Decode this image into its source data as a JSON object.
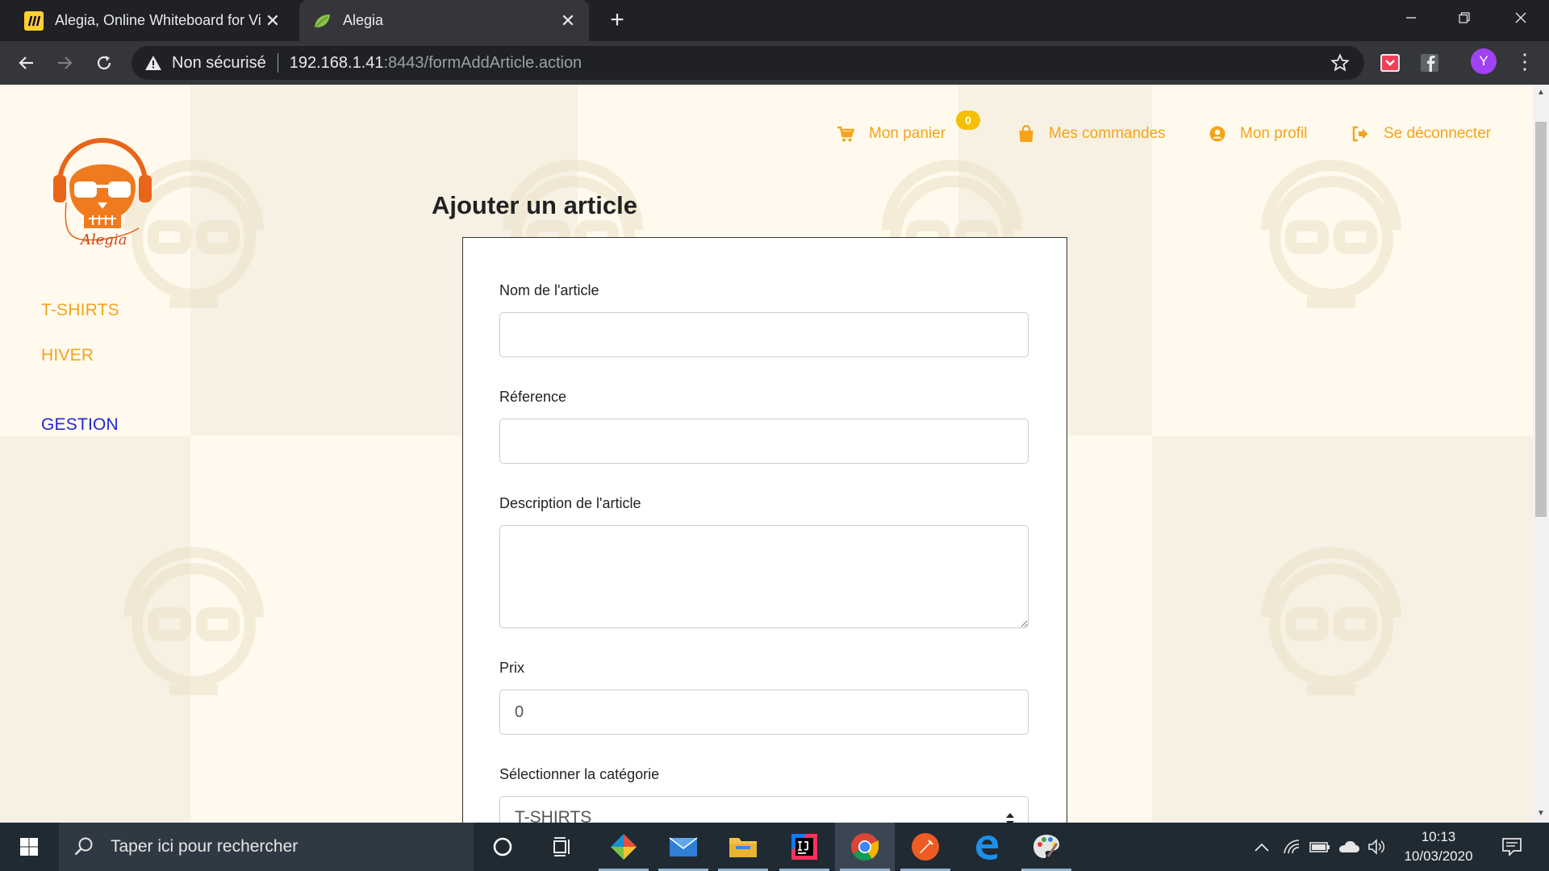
{
  "browser": {
    "tabs": [
      {
        "title": "Alegia, Online Whiteboard for Vi",
        "active": false
      },
      {
        "title": "Alegia",
        "active": true
      }
    ],
    "address": {
      "security_label": "Non sécurisé",
      "host": "192.168.1.41",
      "path": ":8443/formAddArticle.action"
    },
    "profile_initial": "Y"
  },
  "site": {
    "logo_text": "Alegia",
    "sidebar": {
      "items": [
        {
          "label": "T-SHIRTS"
        },
        {
          "label": "HIVER"
        },
        {
          "label": "GESTION"
        }
      ]
    },
    "topnav": {
      "cart_label": "Mon panier",
      "cart_count": "0",
      "orders_label": "Mes commandes",
      "profile_label": "Mon profil",
      "logout_label": "Se déconnecter"
    },
    "colors": {
      "accent": "#f5a31a",
      "link_blue": "#2525d0",
      "badge": "#f5c000"
    }
  },
  "form": {
    "title": "Ajouter un article",
    "fields": {
      "name_label": "Nom de l'article",
      "name_value": "",
      "reference_label": "Réference",
      "reference_value": "",
      "description_label": "Description de l'article",
      "description_value": "",
      "price_label": "Prix",
      "price_value": "0",
      "category_label": "Sélectionner la catégorie",
      "category_value": "T-SHIRTS"
    }
  },
  "taskbar": {
    "search_placeholder": "Taper ici pour rechercher",
    "time": "10:13",
    "date": "10/03/2020"
  }
}
